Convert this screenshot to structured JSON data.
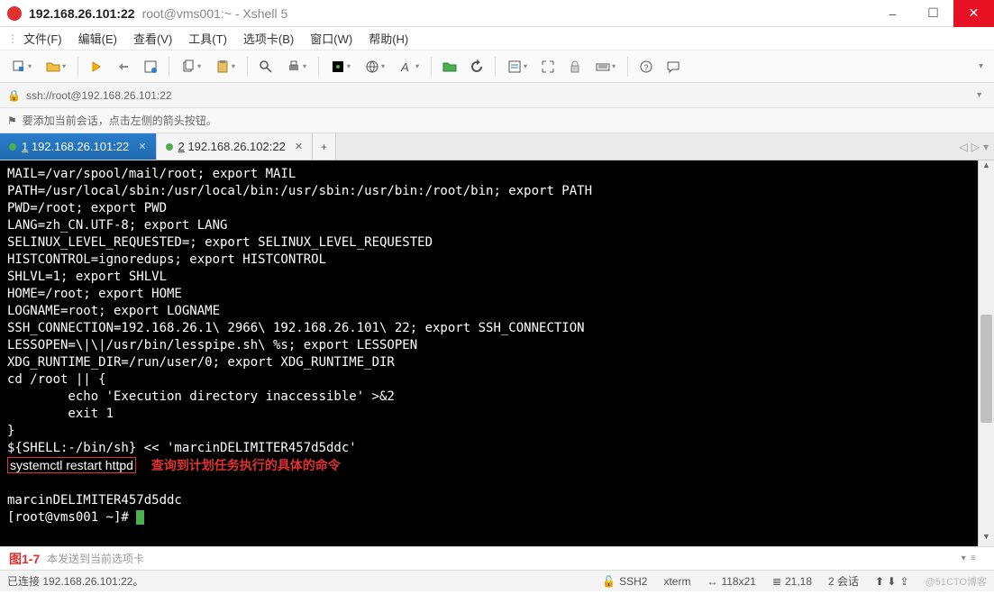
{
  "title": {
    "host": "192.168.26.101:22",
    "app": "root@vms001:~ - Xshell 5"
  },
  "menu": {
    "items": [
      "文件(F)",
      "编辑(E)",
      "查看(V)",
      "工具(T)",
      "选项卡(B)",
      "窗口(W)",
      "帮助(H)"
    ]
  },
  "address": {
    "url": "ssh://root@192.168.26.101:22"
  },
  "info": {
    "text": "要添加当前会话，点击左侧的箭头按钮。"
  },
  "tabs": {
    "items": [
      {
        "label": "1 192.168.26.101:22",
        "active": true
      },
      {
        "label": "2 192.168.26.102:22",
        "active": false
      }
    ]
  },
  "terminal": {
    "lines": [
      "MAIL=/var/spool/mail/root; export MAIL",
      "PATH=/usr/local/sbin:/usr/local/bin:/usr/sbin:/usr/bin:/root/bin; export PATH",
      "PWD=/root; export PWD",
      "LANG=zh_CN.UTF-8; export LANG",
      "SELINUX_LEVEL_REQUESTED=; export SELINUX_LEVEL_REQUESTED",
      "HISTCONTROL=ignoredups; export HISTCONTROL",
      "SHLVL=1; export SHLVL",
      "HOME=/root; export HOME",
      "LOGNAME=root; export LOGNAME",
      "SSH_CONNECTION=192.168.26.1\\ 2966\\ 192.168.26.101\\ 22; export SSH_CONNECTION",
      "LESSOPEN=\\|\\|/usr/bin/lesspipe.sh\\ %s; export LESSOPEN",
      "XDG_RUNTIME_DIR=/run/user/0; export XDG_RUNTIME_DIR",
      "cd /root || {",
      "        echo 'Execution directory inaccessible' >&2",
      "        exit 1",
      "}",
      "${SHELL:-/bin/sh} << 'marcinDELIMITER457d5ddc'"
    ],
    "highlight_cmd": "systemctl restart httpd",
    "annotation": "查询到计划任务执行的具体的命令",
    "tail": [
      "",
      "marcinDELIMITER457d5ddc",
      "[root@vms001 ~]# "
    ]
  },
  "inputline": {
    "placeholder": "本发送到当前选项卡",
    "figure": "图1-7"
  },
  "status": {
    "conn": "已连接 192.168.26.101:22。",
    "proto": "SSH2",
    "term": "xterm",
    "size": "118x21",
    "cursor": "21,18",
    "sessions": "2 会话",
    "watermark": "@51CTO博客"
  },
  "icons": {
    "minimize": "–",
    "maximize": "☐",
    "close": "✕",
    "arrow": "➤",
    "flag": "⚑",
    "lock": "🔒",
    "caps": "⇪",
    "plus": "+",
    "left": "◁",
    "right": "▷",
    "down": "▾",
    "sizei": "↔",
    "posi": "≣",
    "sessi": "⟳"
  }
}
